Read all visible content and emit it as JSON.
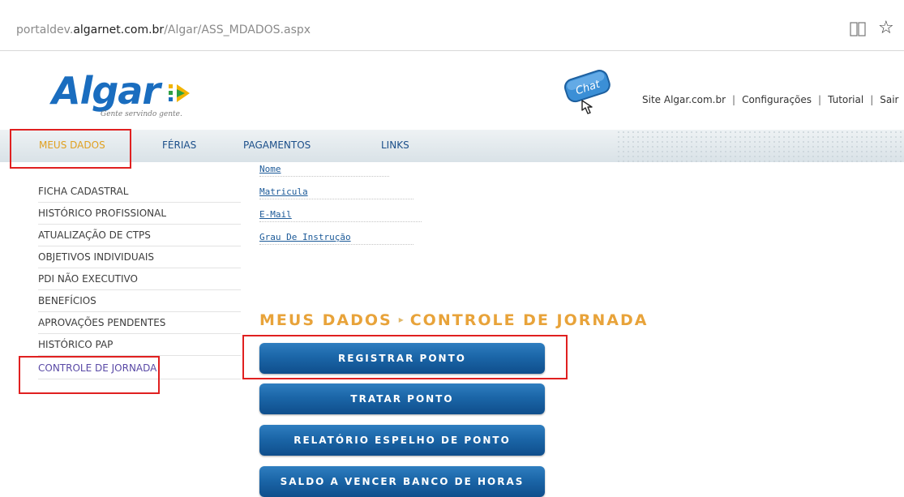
{
  "browser": {
    "url_prefix": "portaldev.",
    "url_domain": "algarnet.com.br",
    "url_path": "/Algar/ASS_MDADOS.aspx",
    "reading_view_icon": "book-icon",
    "favorite_icon": "☆"
  },
  "header": {
    "logo_text": "Algar",
    "logo_tagline": "Gente servindo gente.",
    "chat_label": "Chat",
    "links": [
      "Site Algar.com.br",
      "Configurações",
      "Tutorial",
      "Sair"
    ],
    "link_separator": "|"
  },
  "nav": {
    "items": [
      "MEUS DADOS",
      "FÉRIAS",
      "PAGAMENTOS",
      "LINKS"
    ],
    "active": "MEUS DADOS"
  },
  "subnav": {
    "links": [
      "Nome",
      "Matricula",
      "E-Mail",
      "Grau De Instrução"
    ]
  },
  "sidebar": {
    "items": [
      "FICHA CADASTRAL",
      "HISTÓRICO PROFISSIONAL",
      "ATUALIZAÇÃO DE CTPS",
      "OBJETIVOS INDIVIDUAIS",
      "PDI NÃO EXECUTIVO",
      "BENEFÍCIOS",
      "APROVAÇÕES PENDENTES",
      "HISTÓRICO PAP",
      "CONTROLE DE JORNADA"
    ]
  },
  "main": {
    "breadcrumb_section": "MEUS DADOS",
    "breadcrumb_chevron": "▸",
    "breadcrumb_page": "CONTROLE DE JORNADA",
    "buttons": [
      "REGISTRAR PONTO",
      "TRATAR PONTO",
      "RELATÓRIO ESPELHO DE PONTO",
      "SALDO A VENCER BANCO DE HORAS"
    ]
  },
  "colors": {
    "nav_active": "#e0a020",
    "nav_link": "#1c4f8a",
    "breadcrumb": "#e8a33a",
    "button": "#1b66a8",
    "annotation": "#e02020",
    "logo": "#1a6dbf"
  }
}
